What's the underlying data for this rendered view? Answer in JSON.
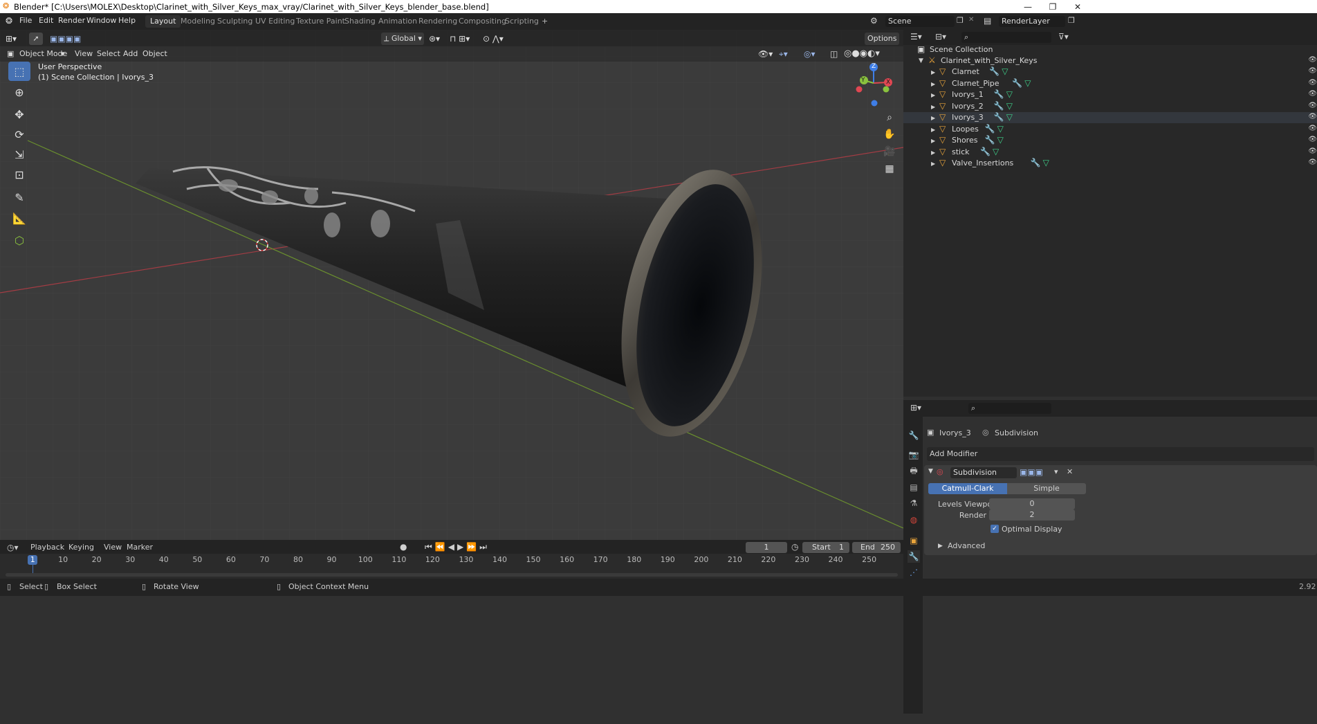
{
  "window": {
    "title": "Blender* [C:\\Users\\MOLEX\\Desktop\\Clarinet_with_Silver_Keys_max_vray/Clarinet_with_Silver_Keys_blender_base.blend]",
    "min_glyph": "—",
    "max_glyph": "❐",
    "close_glyph": "✕"
  },
  "menu": [
    "File",
    "Edit",
    "Render",
    "Window",
    "Help"
  ],
  "workspaces": [
    "Layout",
    "Modeling",
    "Sculpting",
    "UV Editing",
    "Texture Paint",
    "Shading",
    "Animation",
    "Rendering",
    "Compositing",
    "Scripting",
    "+"
  ],
  "scene": {
    "label": "Scene",
    "render_layer": "RenderLayer"
  },
  "viewport": {
    "mode": "Object Mode",
    "menus": [
      "View",
      "Select",
      "Add",
      "Object"
    ],
    "transform": "Global",
    "options": "Options",
    "overlay_title": "User Perspective",
    "overlay_sub": "(1) Scene Collection | Ivorys_3",
    "gizmo": {
      "z": "Z",
      "y": "Y",
      "x": "X"
    }
  },
  "outliner": {
    "root": "Scene Collection",
    "collection": "Clarinet_with_Silver_Keys",
    "items": [
      "Clarnet",
      "Clarnet_Pipe",
      "Ivorys_1",
      "Ivorys_2",
      "Ivorys_3",
      "Loopes",
      "Shores",
      "stick",
      "Valve_Insertions"
    ]
  },
  "properties": {
    "object": "Ivorys_3",
    "modifier_tab": "Subdivision",
    "add_modifier": "Add Modifier",
    "modifier_name": "Subdivision",
    "mode_a": "Catmull-Clark",
    "mode_b": "Simple",
    "levels_label": "Levels Viewport",
    "levels_value": "0",
    "render_label": "Render",
    "render_value": "2",
    "optimal": "Optimal Display",
    "advanced": "Advanced"
  },
  "timeline": {
    "menus": [
      "Playback",
      "Keying",
      "View",
      "Marker"
    ],
    "frame": "1",
    "start_label": "Start",
    "start": "1",
    "end_label": "End",
    "end": "250",
    "ticks": [
      "1",
      "10",
      "20",
      "30",
      "40",
      "50",
      "60",
      "70",
      "80",
      "90",
      "100",
      "110",
      "120",
      "130",
      "140",
      "150",
      "160",
      "170",
      "180",
      "190",
      "200",
      "210",
      "220",
      "230",
      "240",
      "250"
    ]
  },
  "status": {
    "select": "Select",
    "box": "Box Select",
    "rotate": "Rotate View",
    "context": "Object Context Menu",
    "version": "2.92"
  },
  "colors": {
    "accent": "#4772b3",
    "bg": "#303030",
    "header": "#232323",
    "x_axis": "#e04752",
    "y_axis": "#8ac23e",
    "z_axis": "#3f7ee6"
  }
}
